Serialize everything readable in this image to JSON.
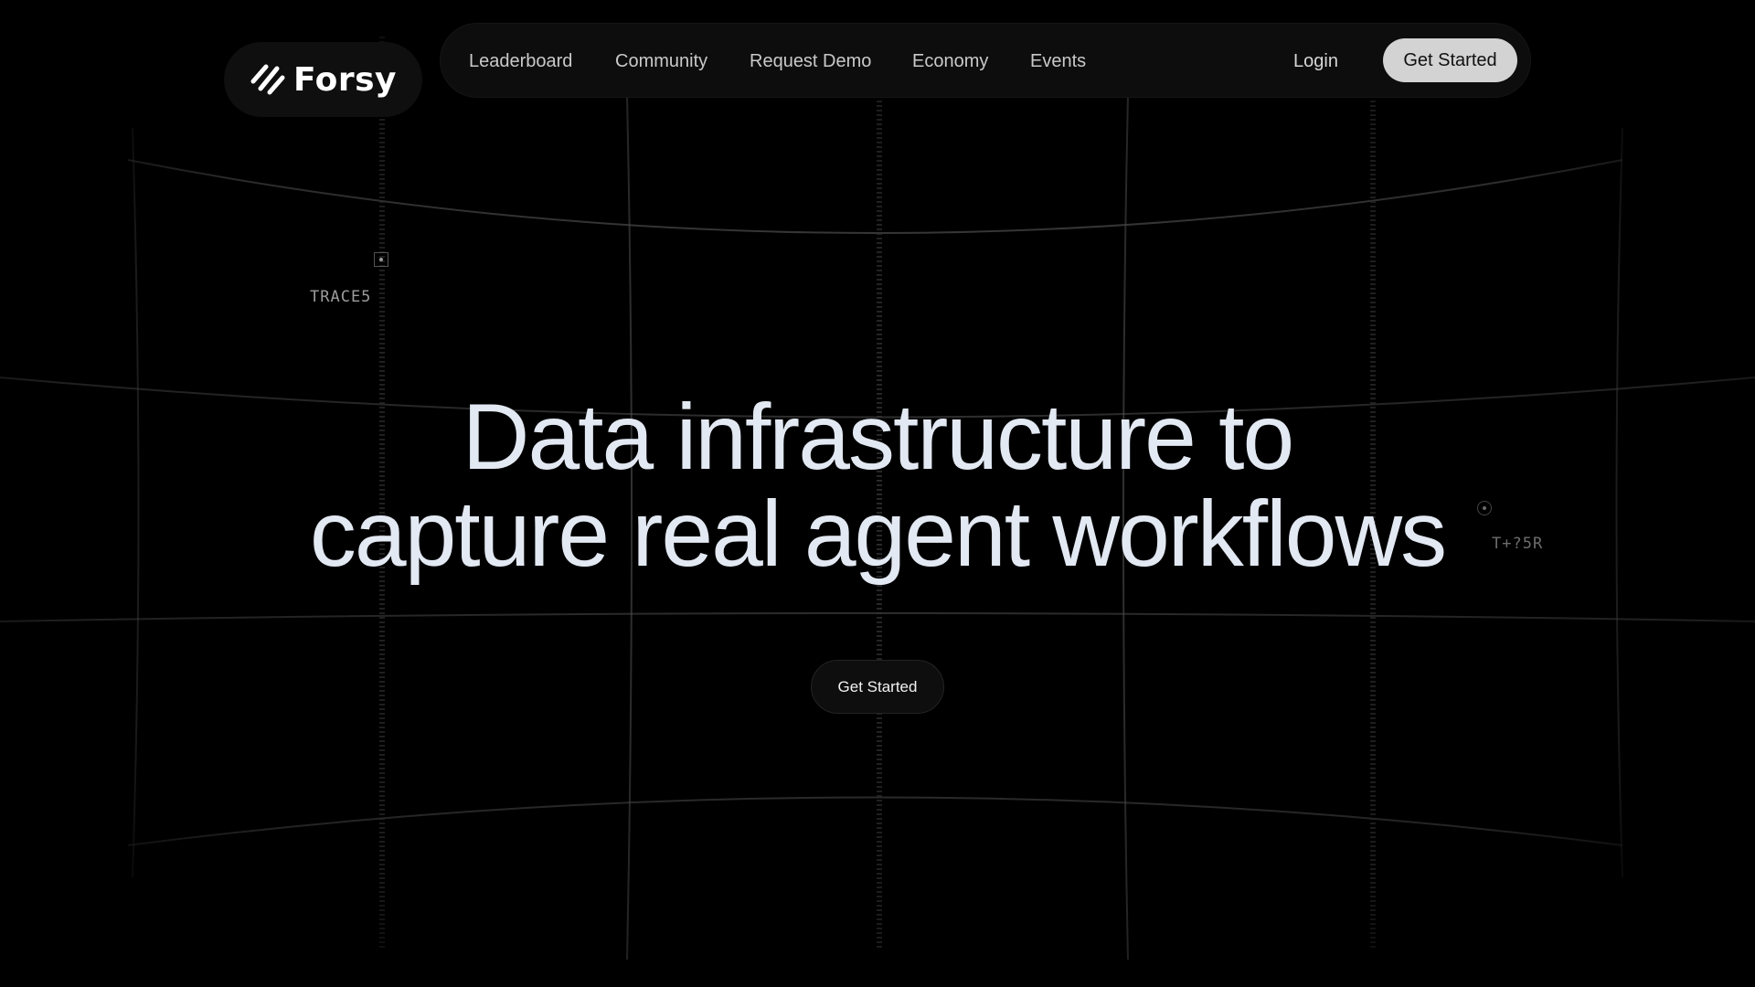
{
  "brand": {
    "name": "Forsy",
    "icon": "forsy-logo-icon"
  },
  "nav": {
    "links": [
      {
        "label": "Leaderboard"
      },
      {
        "label": "Community"
      },
      {
        "label": "Request Demo"
      },
      {
        "label": "Economy"
      },
      {
        "label": "Events"
      }
    ],
    "login": "Login",
    "cta": "Get Started"
  },
  "hero": {
    "title_line1": "Data infrastructure to",
    "title_line2": "capture real agent workflows",
    "cta": "Get Started"
  },
  "traces": {
    "left": {
      "label": "TRACE5",
      "icon": "square-target-icon"
    },
    "right": {
      "label": "T+?5R",
      "icon": "circle-target-icon"
    }
  },
  "colors": {
    "background": "#000000",
    "title": "#e3e9f3",
    "nav_cta_bg": "#d3d3d3",
    "grid": "#5a5a5a"
  }
}
